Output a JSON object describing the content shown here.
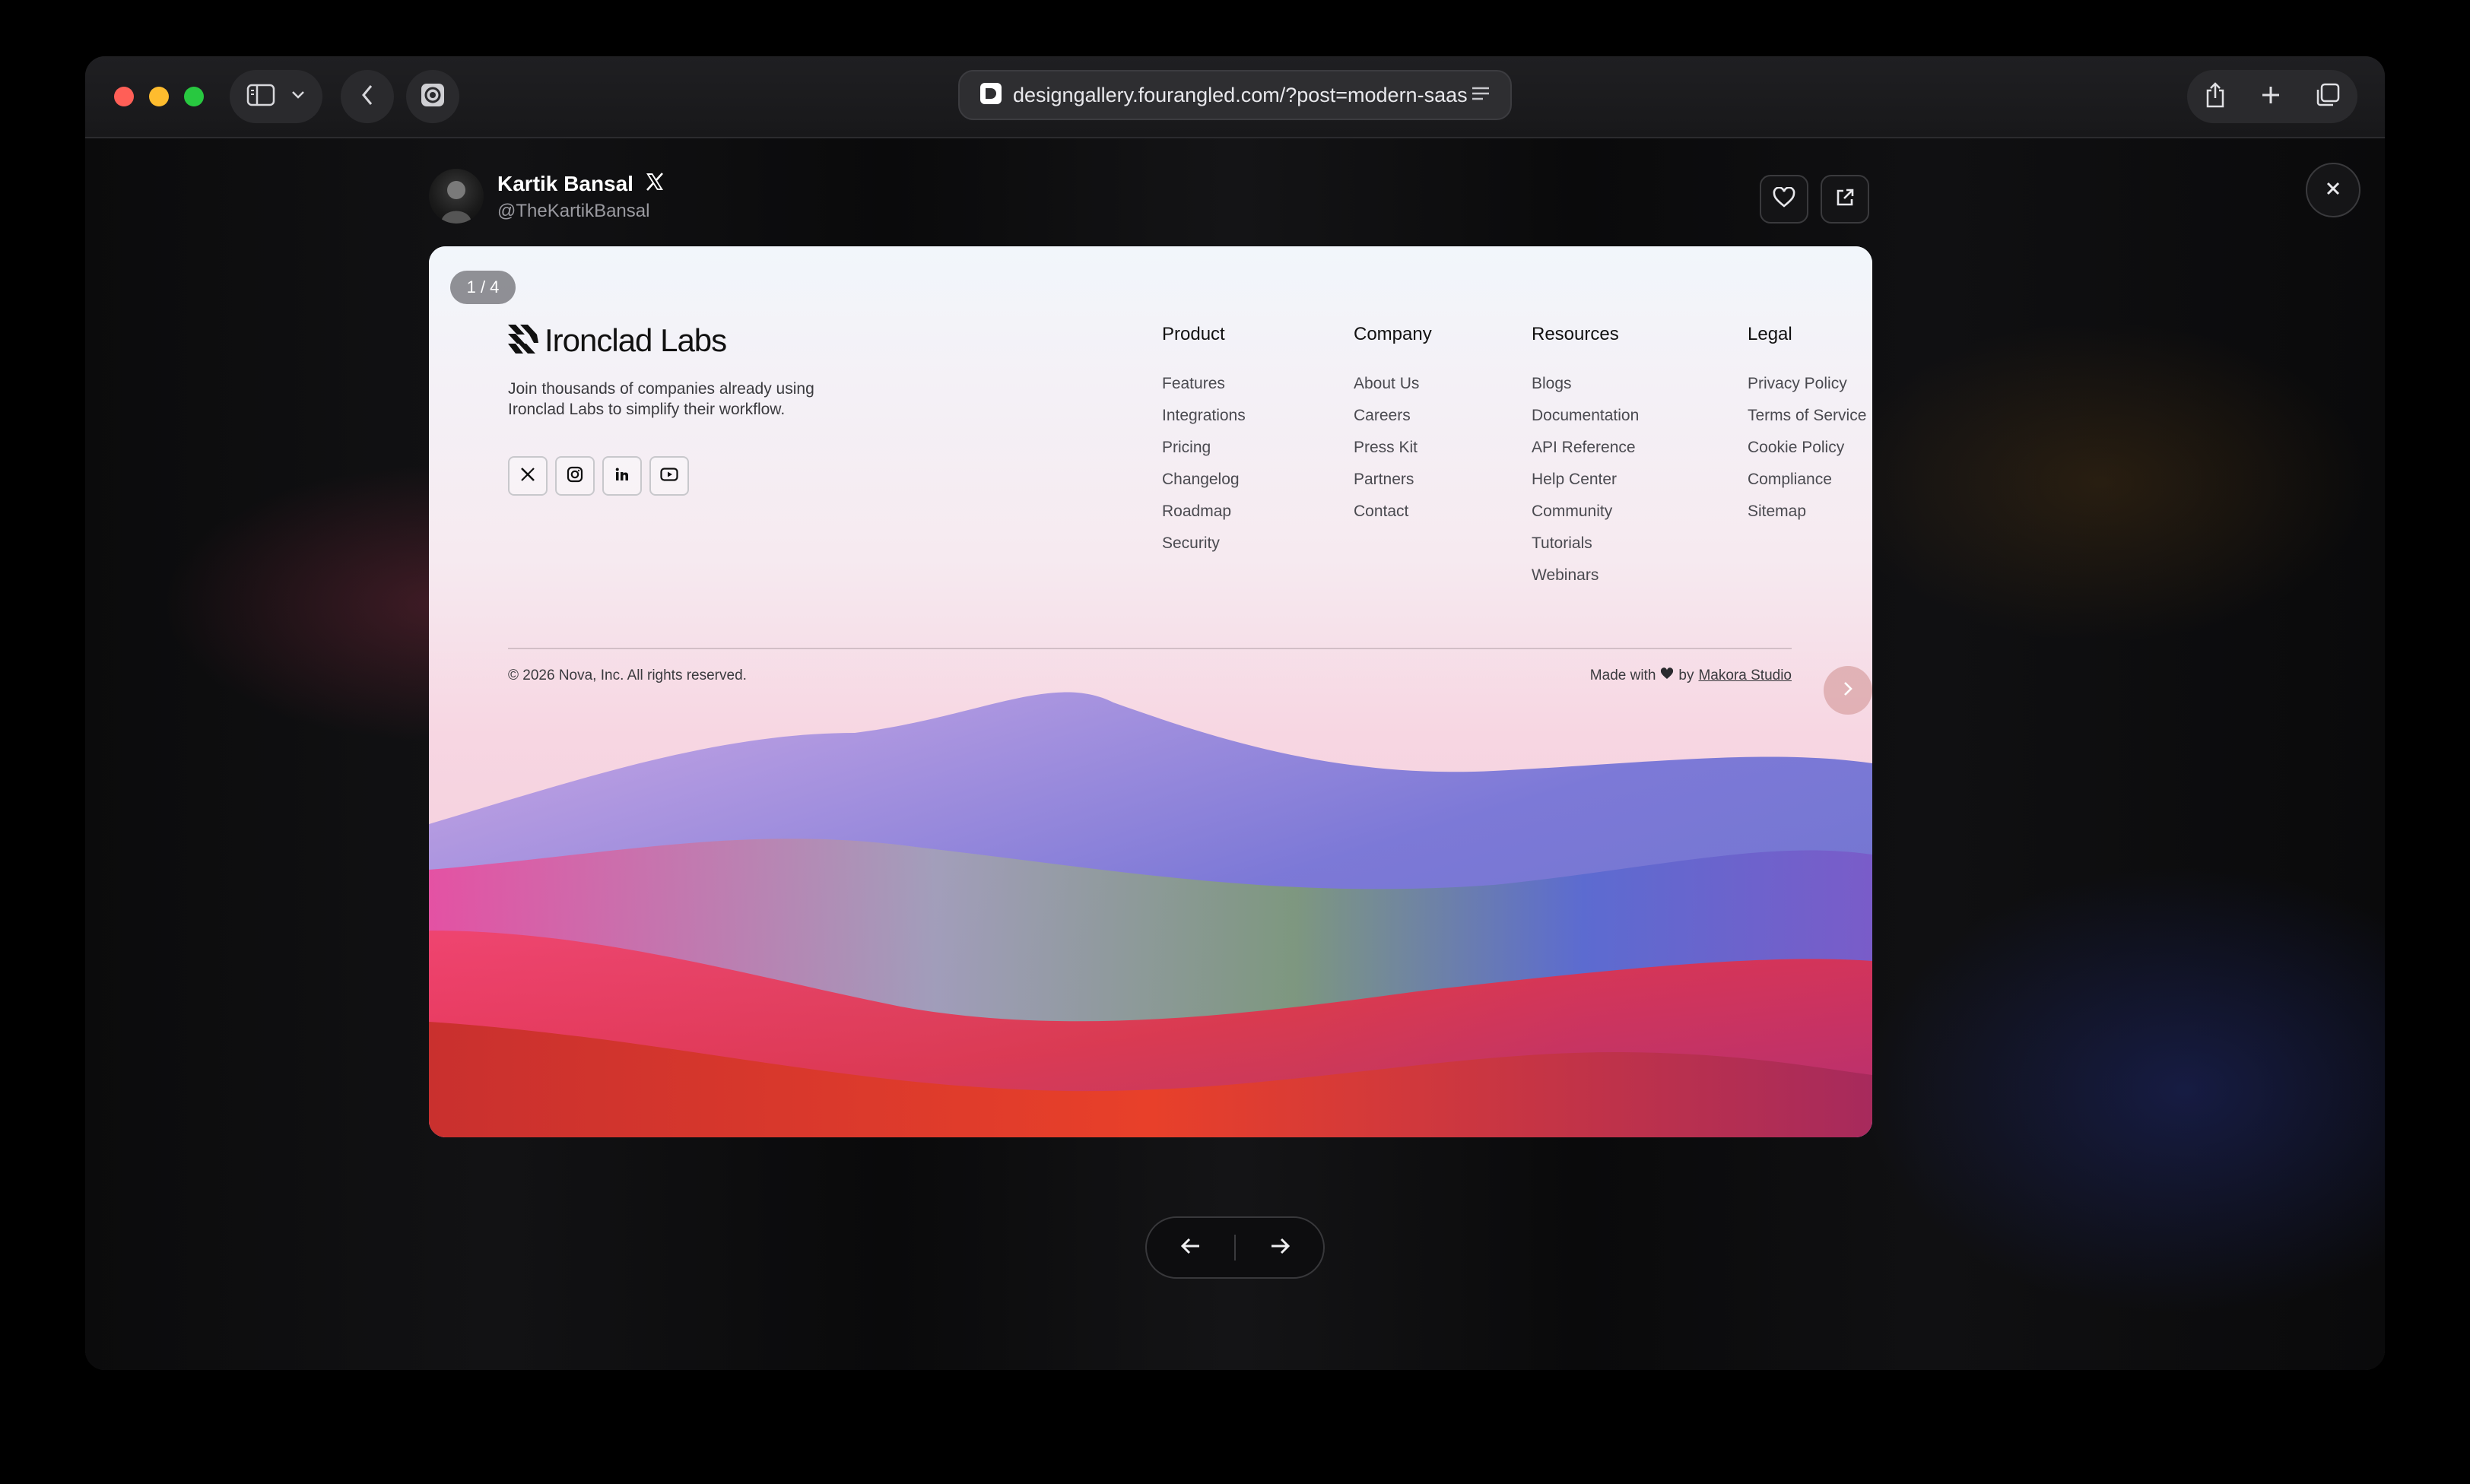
{
  "browser": {
    "url": "designgallery.fourangled.com/?post=modern-saas",
    "icons": [
      "sidebar-icon",
      "chevron-down-icon",
      "back-icon",
      "extension-icon",
      "reader-icon",
      "share-icon",
      "new-tab-icon",
      "tabs-overview-icon"
    ]
  },
  "author": {
    "name": "Kartik Bansal",
    "handle": "@TheKartikBansal",
    "platform_icon": "x-logo-icon"
  },
  "actions": {
    "like_icon": "heart-icon",
    "open_icon": "external-link-icon",
    "close_icon": "close-icon"
  },
  "card": {
    "counter": "1 / 4",
    "brand": "Ironclad Labs",
    "tagline": "Join thousands of companies already using Ironclad Labs to simplify their workflow.",
    "socials": [
      "x-icon",
      "instagram-icon",
      "linkedin-icon",
      "youtube-icon"
    ],
    "columns": [
      {
        "title": "Product",
        "links": [
          "Features",
          "Integrations",
          "Pricing",
          "Changelog",
          "Roadmap",
          "Security"
        ]
      },
      {
        "title": "Company",
        "links": [
          "About Us",
          "Careers",
          "Press Kit",
          "Partners",
          "Contact"
        ]
      },
      {
        "title": "Resources",
        "links": [
          "Blogs",
          "Documentation",
          "API Reference",
          "Help Center",
          "Community",
          "Tutorials",
          "Webinars"
        ]
      },
      {
        "title": "Legal",
        "links": [
          "Privacy Policy",
          "Terms of Service",
          "Cookie Policy",
          "Compliance",
          "Sitemap"
        ]
      }
    ],
    "copyright": "© 2026 Nova, Inc. All rights reserved.",
    "made_with": "Made with",
    "made_by": "by",
    "studio": "Makora Studio"
  },
  "pager": {
    "prev_icon": "arrow-left-icon",
    "next_icon": "arrow-right-icon"
  },
  "colors": {
    "traffic_red": "#ff5f57",
    "traffic_yellow": "#febc2e",
    "traffic_green": "#28c840"
  }
}
